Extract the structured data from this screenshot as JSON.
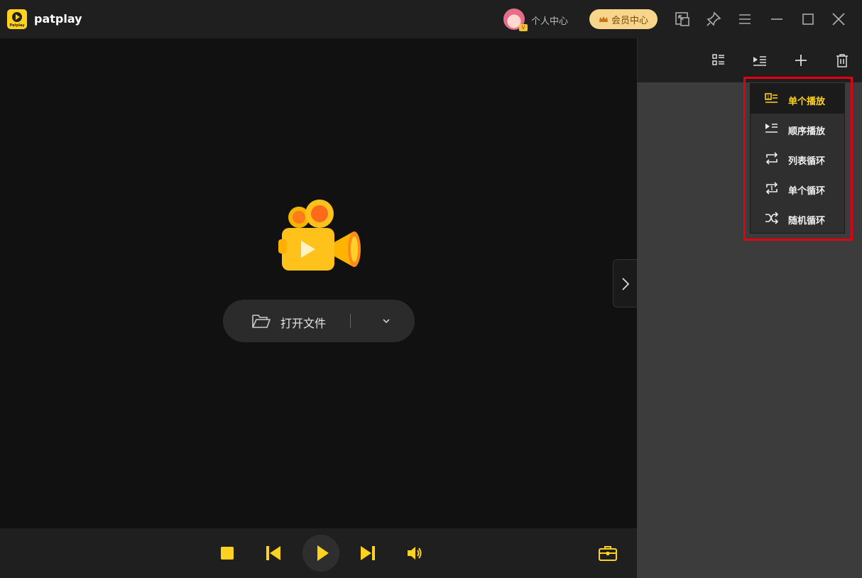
{
  "app": {
    "title": "patplay",
    "logo_text": "Patplay"
  },
  "header": {
    "user_center_label": "个人中心",
    "vip_label": "会员中心",
    "vip_badge": "V"
  },
  "main": {
    "open_file_label": "打开文件"
  },
  "play_mode_menu": {
    "items": [
      {
        "label": "单个播放",
        "icon": "single-play-icon",
        "active": true
      },
      {
        "label": "顺序播放",
        "icon": "sequential-play-icon",
        "active": false
      },
      {
        "label": "列表循环",
        "icon": "list-loop-icon",
        "active": false
      },
      {
        "label": "单个循环",
        "icon": "single-loop-icon",
        "active": false
      },
      {
        "label": "随机循环",
        "icon": "shuffle-icon",
        "active": false
      }
    ]
  },
  "colors": {
    "accent": "#ffd21f",
    "highlight_frame": "#e0000f",
    "vip_bg": "#f7d58a"
  }
}
